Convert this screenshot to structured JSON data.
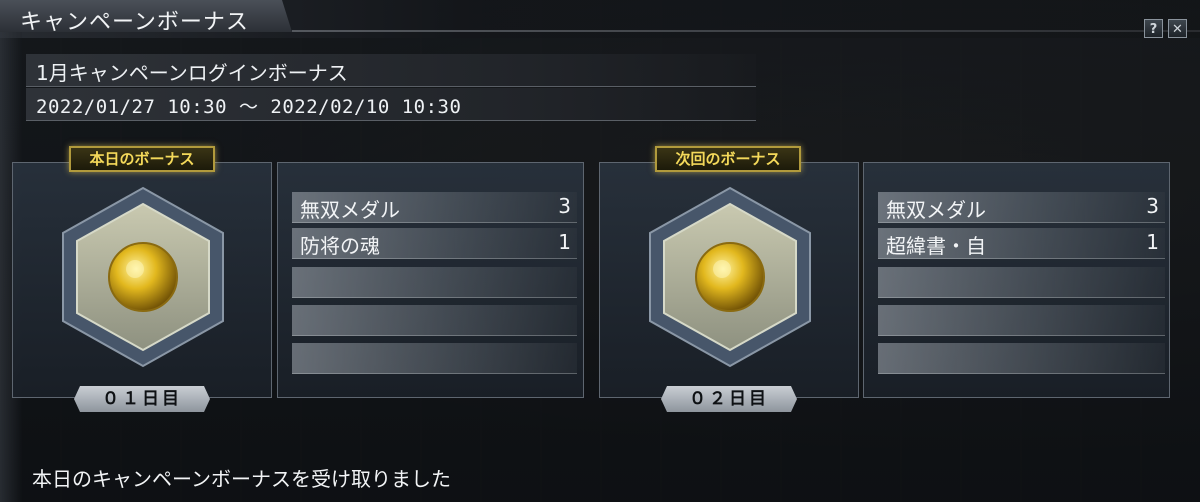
{
  "window": {
    "title": "キャンペーンボーナス",
    "help_label": "?",
    "close_label": "✕"
  },
  "campaign": {
    "name": "1月キャンペーンログインボーナス",
    "period": "2022/01/27 10:30 〜 2022/02/10 10:30"
  },
  "today": {
    "badge": "本日のボーナス",
    "day_label": "０１日目",
    "icon": "gold-coin-icon",
    "items": [
      {
        "name": "無双メダル",
        "qty": "3"
      },
      {
        "name": "防将の魂",
        "qty": "1"
      },
      {
        "name": "",
        "qty": ""
      },
      {
        "name": "",
        "qty": ""
      },
      {
        "name": "",
        "qty": ""
      }
    ]
  },
  "next": {
    "badge": "次回のボーナス",
    "day_label": "０２日目",
    "icon": "gold-coin-icon",
    "items": [
      {
        "name": "無双メダル",
        "qty": "3"
      },
      {
        "name": "超緯書・自",
        "qty": "1"
      },
      {
        "name": "",
        "qty": ""
      },
      {
        "name": "",
        "qty": ""
      },
      {
        "name": "",
        "qty": ""
      }
    ]
  },
  "footer": {
    "message": "本日のキャンペーンボーナスを受け取りました"
  },
  "colors": {
    "badge_gold": "#f4d95a",
    "panel_border": "#5e6670",
    "coin": "#e2b81e"
  }
}
